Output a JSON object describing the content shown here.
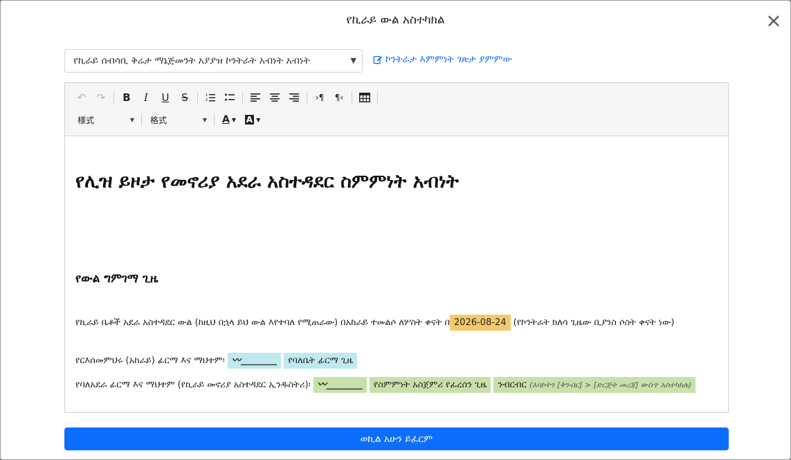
{
  "modal": {
    "title": "የኪራይ ውል አስተካክል",
    "close_symbol": "×"
  },
  "template_select": {
    "value": "የኪራይ ሰብሳቢ ቅሬታ ማኔጅመንት አያያዝ ኮንትራት አብነት አብነት"
  },
  "preview_link": {
    "label": "ኮንትራታ እምምነት ገጽታ ያምምው"
  },
  "toolbar": {
    "undo": "↶",
    "redo": "↷",
    "bold": "B",
    "italic": "I",
    "underline": "U",
    "strike": "S",
    "align_left": "≡",
    "align_center": "≡",
    "align_right": "≡",
    "ltr": "›¶",
    "rtl": "¶‹",
    "style_select": "様式",
    "format_select": "格式",
    "font_color": "A",
    "bg_color": "A"
  },
  "document": {
    "title": "የሊዝ ይዞታ የመኖሪያ አደራ አስተዳደር ስምምነት አብነት",
    "section_heading": "የውል ግምገማ ጊዜ",
    "p1_before": "የኪራይ ቤቶች አደራ አስተዳደር ውል (ከዚህ በኋላ ይህ ውል እየተባለ የሚጠራው) በአከራይ ተመልሶ ለሦስት ቀናት በ",
    "p1_date": "2026-08-24",
    "p1_after": " (የኮንትራት ክለሳ ጊዜው ቢያንስ ሶስት ቀናት ነው)",
    "p2_label": "የርእሰመምህሩ (አከራይ) ፊርማ እና ማህተም፡",
    "p2_signature": "〰________",
    "p2_date_field": "የባለቤት ፊርማ ጊዜ",
    "p3_label": "የባለአደራ ፊርማ እና ማህተም (የኪራይ መኖሪያ አስተዳደር ኢንዱስትሪ)፡",
    "p3_signature": "〰________",
    "p3_date_field": "የስምምነት አስጀምሪ የፈረሰን ጊዜ",
    "p3_edit_label": "ንብርብር",
    "p3_edit_hint": "(እባኮትን [ቅንብር] > [ድርጅት መረጃ] ውስጥ አስተካክሉ)"
  },
  "submit": {
    "label": "ወኪል አሁን ይፈርም"
  },
  "colors": {
    "primary": "#0d6efd",
    "placeholder_orange": "#f5c96a",
    "placeholder_cyan": "#bfe9ee",
    "placeholder_green": "#c8e0aa"
  }
}
